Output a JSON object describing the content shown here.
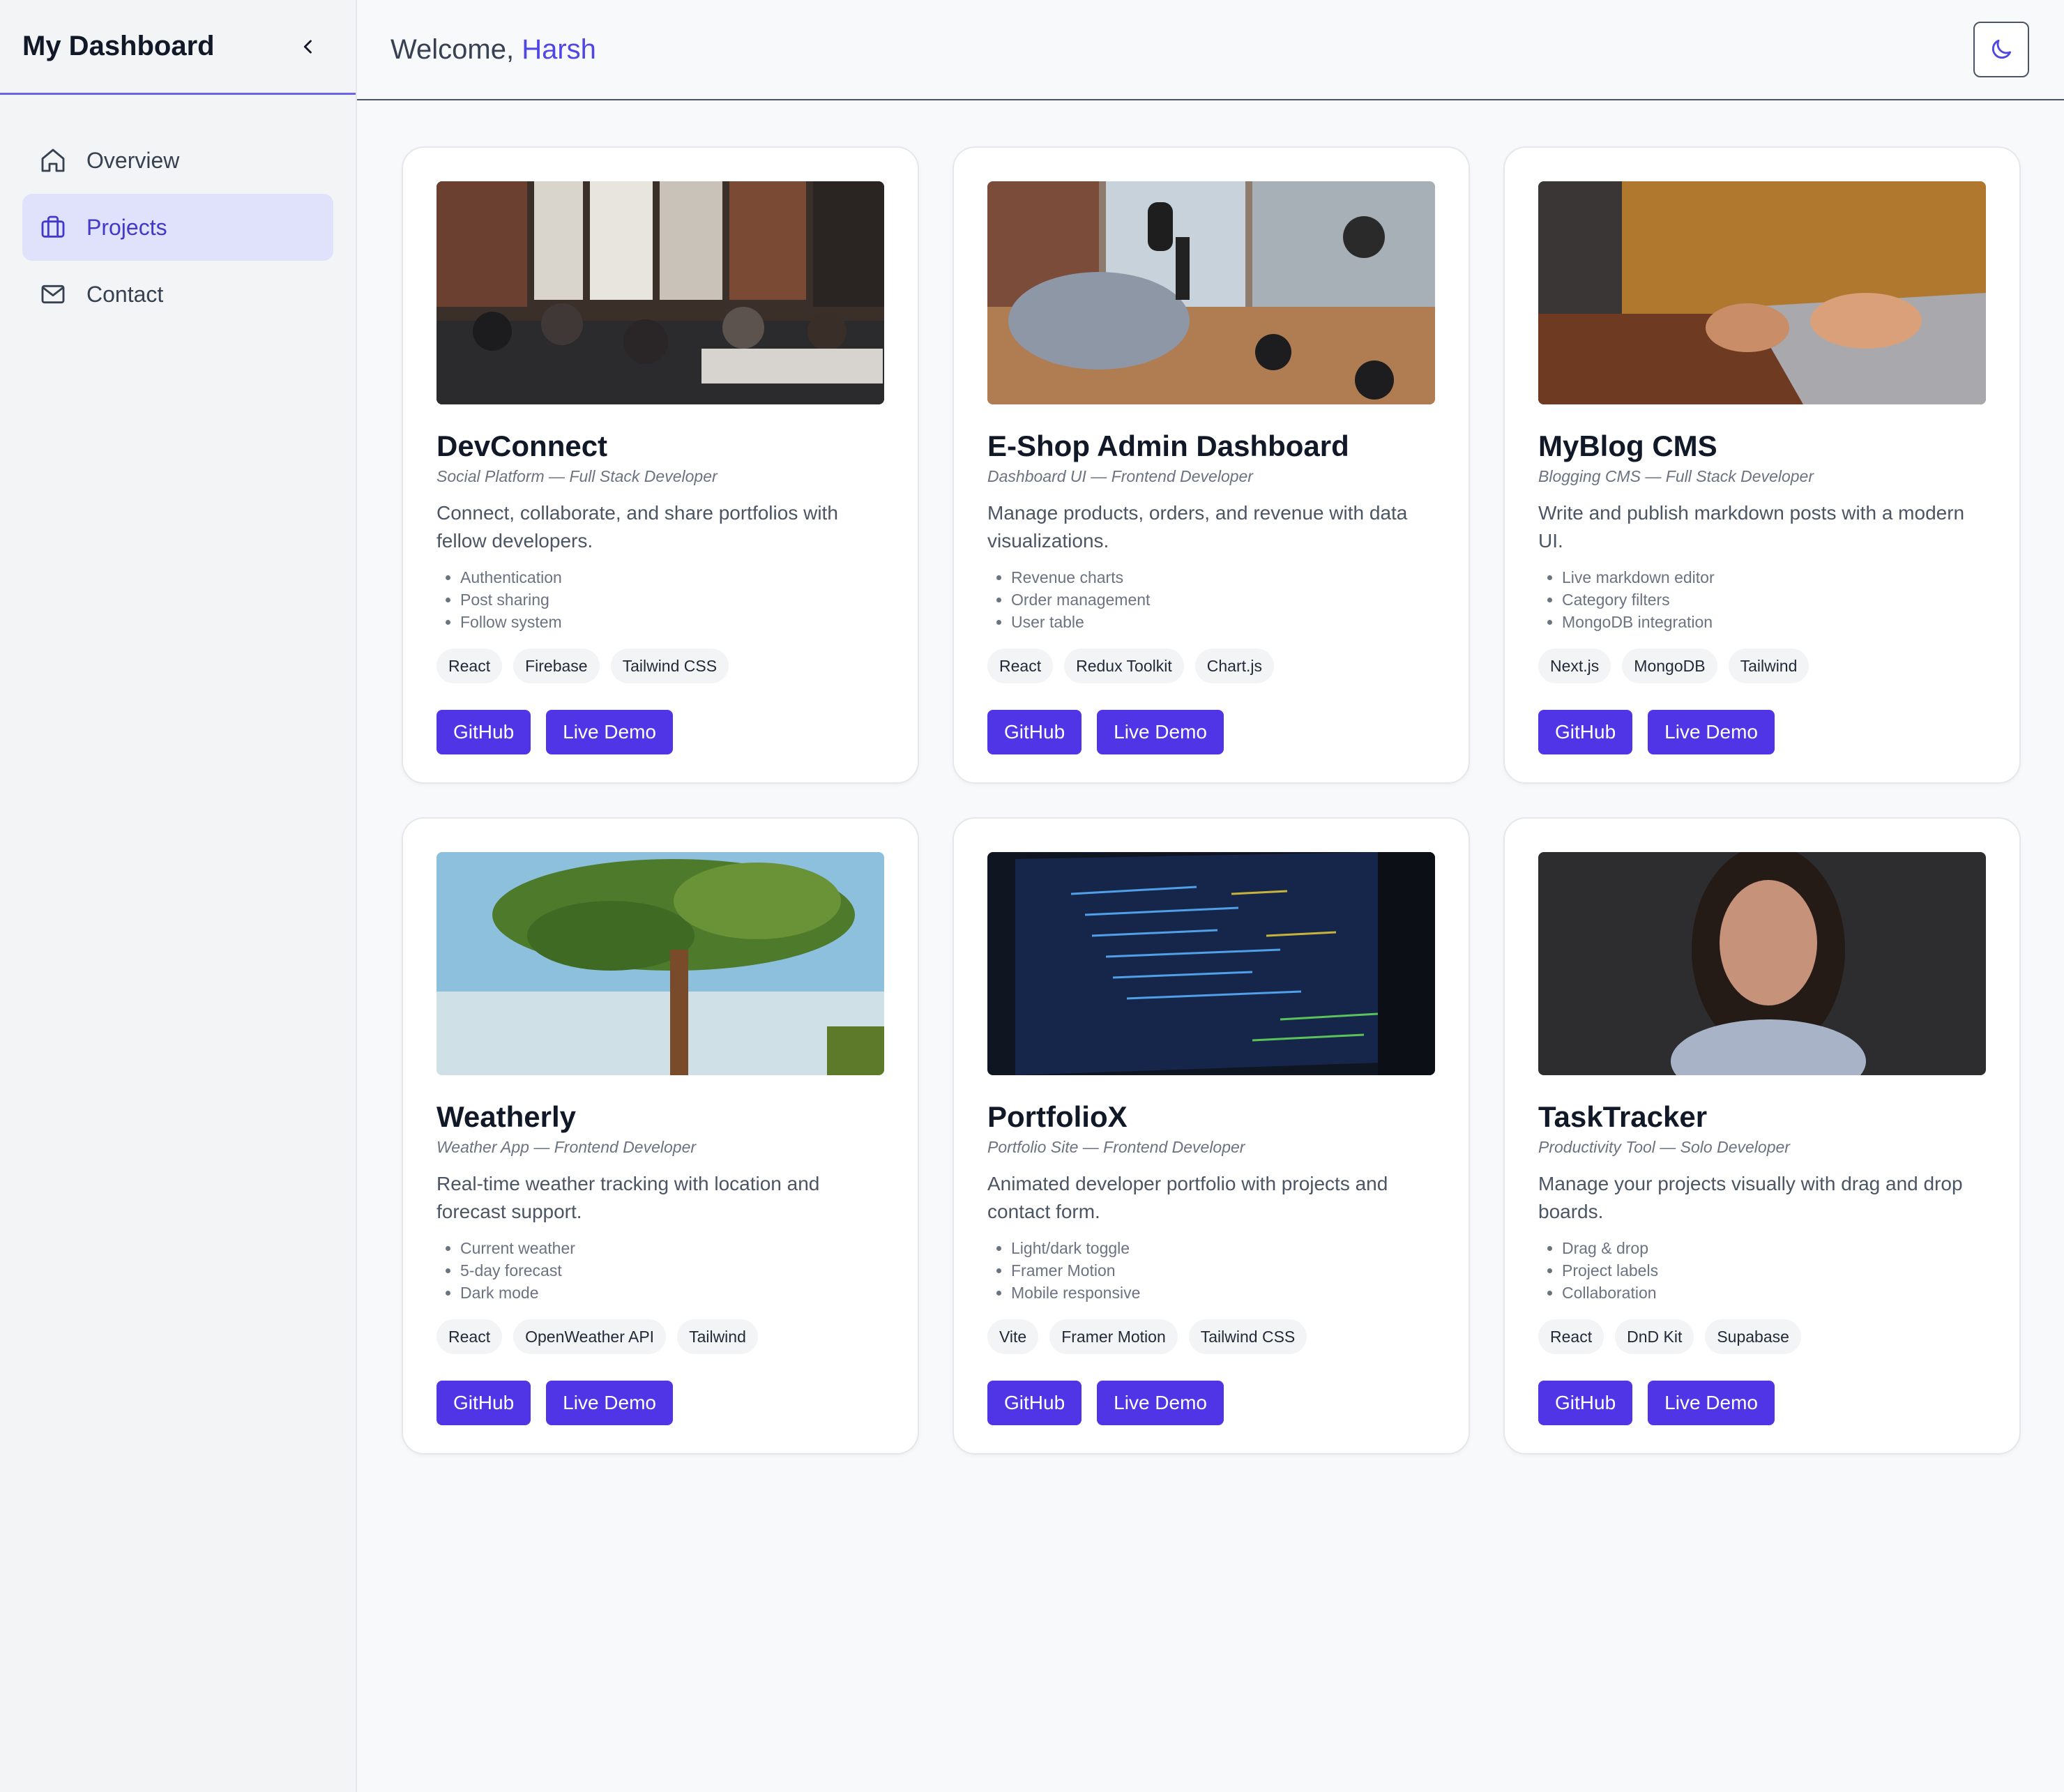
{
  "sidebar": {
    "title": "My Dashboard",
    "items": [
      {
        "label": "Overview",
        "icon": "home-icon",
        "active": false
      },
      {
        "label": "Projects",
        "icon": "briefcase-icon",
        "active": true
      },
      {
        "label": "Contact",
        "icon": "mail-icon",
        "active": false
      }
    ]
  },
  "header": {
    "welcome": "Welcome,",
    "user": "Harsh"
  },
  "colors": {
    "accent": "#4f35e6",
    "active_nav_bg": "#e0e2fb"
  },
  "projects": [
    {
      "title": "DevConnect",
      "subtitle": "Social Platform — Full Stack Developer",
      "description": "Connect, collaborate, and share portfolios with fellow developers.",
      "features": [
        "Authentication",
        "Post sharing",
        "Follow system"
      ],
      "tags": [
        "React",
        "Firebase",
        "Tailwind CSS"
      ],
      "buttons": [
        "GitHub",
        "Live Demo"
      ]
    },
    {
      "title": "E-Shop Admin Dashboard",
      "subtitle": "Dashboard UI — Frontend Developer",
      "description": "Manage products, orders, and revenue with data visualizations.",
      "features": [
        "Revenue charts",
        "Order management",
        "User table"
      ],
      "tags": [
        "React",
        "Redux Toolkit",
        "Chart.js"
      ],
      "buttons": [
        "GitHub",
        "Live Demo"
      ]
    },
    {
      "title": "MyBlog CMS",
      "subtitle": "Blogging CMS — Full Stack Developer",
      "description": "Write and publish markdown posts with a modern UI.",
      "features": [
        "Live markdown editor",
        "Category filters",
        "MongoDB integration"
      ],
      "tags": [
        "Next.js",
        "MongoDB",
        "Tailwind"
      ],
      "buttons": [
        "GitHub",
        "Live Demo"
      ]
    },
    {
      "title": "Weatherly",
      "subtitle": "Weather App — Frontend Developer",
      "description": "Real-time weather tracking with location and forecast support.",
      "features": [
        "Current weather",
        "5-day forecast",
        "Dark mode"
      ],
      "tags": [
        "React",
        "OpenWeather API",
        "Tailwind"
      ],
      "buttons": [
        "GitHub",
        "Live Demo"
      ]
    },
    {
      "title": "PortfolioX",
      "subtitle": "Portfolio Site — Frontend Developer",
      "description": "Animated developer portfolio with projects and contact form.",
      "features": [
        "Light/dark toggle",
        "Framer Motion",
        "Mobile responsive"
      ],
      "tags": [
        "Vite",
        "Framer Motion",
        "Tailwind CSS"
      ],
      "buttons": [
        "GitHub",
        "Live Demo"
      ]
    },
    {
      "title": "TaskTracker",
      "subtitle": "Productivity Tool — Solo Developer",
      "description": "Manage your projects visually with drag and drop boards.",
      "features": [
        "Drag & drop",
        "Project labels",
        "Collaboration"
      ],
      "tags": [
        "React",
        "DnD Kit",
        "Supabase"
      ],
      "buttons": [
        "GitHub",
        "Live Demo"
      ]
    }
  ]
}
